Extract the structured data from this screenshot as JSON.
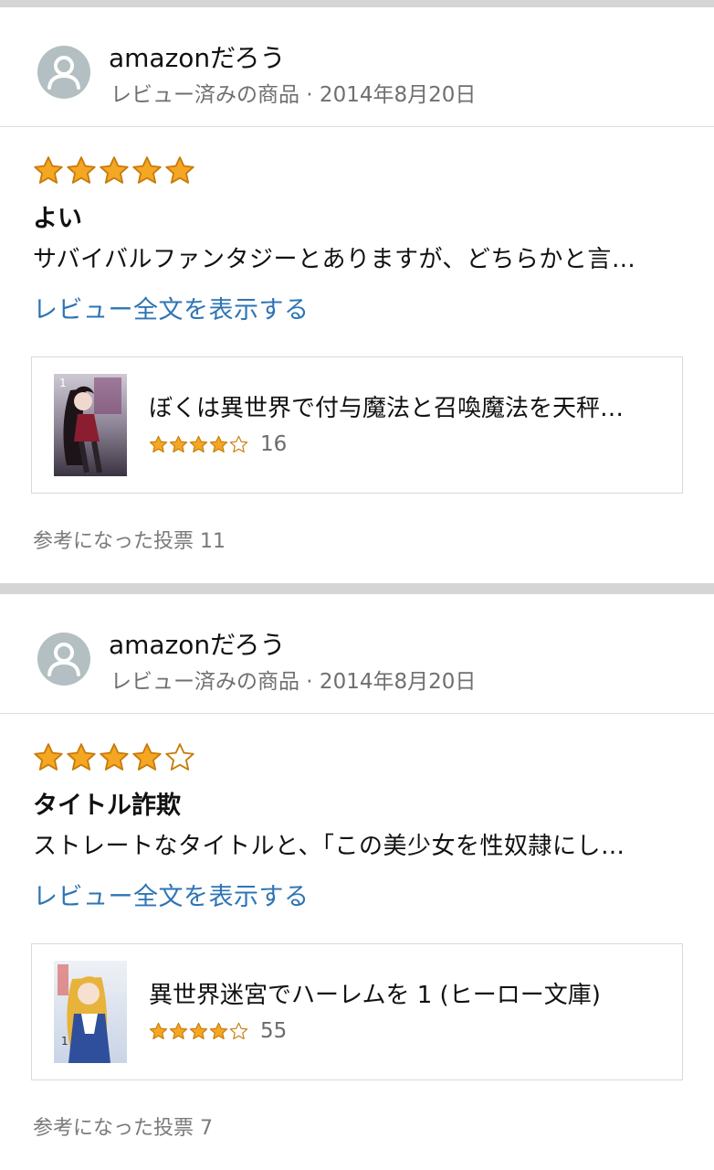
{
  "colors": {
    "link": "#2e74b5",
    "star_fill": "#f5a623",
    "star_stroke": "#c77b0a"
  },
  "reviews": [
    {
      "author": "amazonだろう",
      "meta": "レビュー済みの商品 · 2014年8月20日",
      "rating": 5,
      "title": "よい",
      "text": "サバイバルファンタジーとありますが、どちらかと言…",
      "read_more": "レビュー全文を表示する",
      "product": {
        "title": "ぼくは異世界で付与魔法と召喚魔法を天秤…",
        "rating": 4,
        "count": "16"
      },
      "votes": "参考になった投票 11"
    },
    {
      "author": "amazonだろう",
      "meta": "レビュー済みの商品 · 2014年8月20日",
      "rating": 4,
      "title": "タイトル詐欺",
      "text": "ストレートなタイトルと、「この美少女を性奴隷にし…",
      "read_more": "レビュー全文を表示する",
      "product": {
        "title": "異世界迷宮でハーレムを 1 (ヒーロー文庫)",
        "rating": 4,
        "count": "55"
      },
      "votes": "参考になった投票 7"
    }
  ]
}
